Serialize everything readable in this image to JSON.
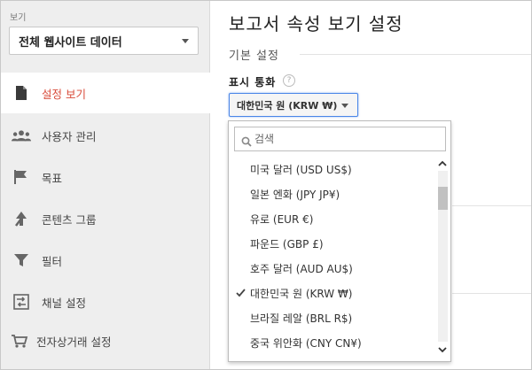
{
  "sidebar": {
    "view_label": "보기",
    "view_selected": "전체 웹사이트 데이터",
    "items": [
      {
        "label": "설정 보기",
        "icon": "document-icon",
        "active": true
      },
      {
        "label": "사용자 관리",
        "icon": "users-icon",
        "active": false
      },
      {
        "label": "목표",
        "icon": "flag-icon",
        "active": false
      },
      {
        "label": "콘텐츠 그룹",
        "icon": "content-grouping-icon",
        "active": false
      },
      {
        "label": "필터",
        "icon": "filter-icon",
        "active": false
      },
      {
        "label": "채널 설정",
        "icon": "channel-settings-icon",
        "active": false
      },
      {
        "label": "전자상거래 설정",
        "icon": "cart-icon",
        "active": false
      }
    ]
  },
  "main": {
    "title": "보고서 속성 보기 설정",
    "section_title": "기본 설정",
    "currency_label": "표시 통화",
    "help_glyph": "?",
    "currency_selected": "대한민국 원 (KRW ₩)"
  },
  "dropdown": {
    "search_placeholder": "검색",
    "search_value": "",
    "options": [
      {
        "label": "미국 달러 (USD US$)",
        "checked": false
      },
      {
        "label": "일본 엔화 (JPY JP¥)",
        "checked": false
      },
      {
        "label": "유로 (EUR €)",
        "checked": false
      },
      {
        "label": "파운드 (GBP £)",
        "checked": false
      },
      {
        "label": "호주 달러 (AUD AU$)",
        "checked": false
      },
      {
        "label": "대한민국 원 (KRW ₩)",
        "checked": true
      },
      {
        "label": "브라질 레알 (BRL R$)",
        "checked": false
      },
      {
        "label": "중국 위안화 (CNY CN¥)",
        "checked": false
      }
    ]
  },
  "colors": {
    "active_nav": "#d84b3a",
    "sidebar_bg": "#eeeeee",
    "focus_border": "#4a86e8"
  }
}
